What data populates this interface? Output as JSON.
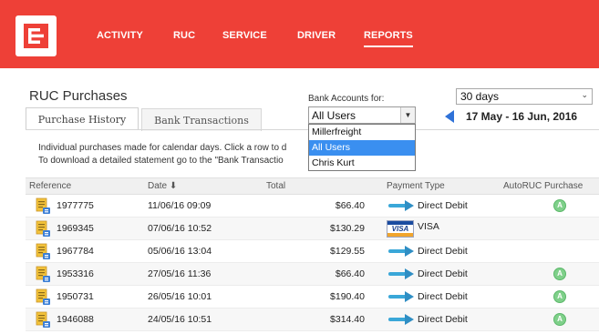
{
  "colors": {
    "brand": "#ee4037",
    "accent": "#2f72d8",
    "selection": "#3a8ff0",
    "autoruc": "#7fd08a"
  },
  "nav": {
    "items": [
      {
        "label": "ACTIVITY",
        "active": false
      },
      {
        "label": "RUC",
        "active": false
      },
      {
        "label": "SERVICE",
        "active": false
      },
      {
        "label": "DRIVER",
        "active": false
      },
      {
        "label": "REPORTS",
        "active": true
      }
    ]
  },
  "page": {
    "title": "RUC Purchases",
    "tabs": [
      {
        "label": "Purchase History",
        "active": true
      },
      {
        "label": "Bank Transactions",
        "active": false
      }
    ]
  },
  "bank_accounts": {
    "label": "Bank Accounts for:",
    "selected": "All Users",
    "options": [
      "Millerfreight",
      "All Users",
      "Chris Kurt"
    ],
    "highlighted": "All Users"
  },
  "period": {
    "selected": "30 days",
    "range": "17 May - 16 Jun, 2016"
  },
  "info": {
    "line1": "Individual purchases made for calendar days. Click a row to d",
    "line2": "To download a detailed statement go to the \"Bank Transactio"
  },
  "table": {
    "columns": [
      "Reference",
      "Date ⬇",
      "Total",
      "Payment Type",
      "AutoRUC Purchase"
    ],
    "rows": [
      {
        "reference": "1977775",
        "date": "11/06/16 09:09",
        "total": "$66.40",
        "payment": "Direct Debit",
        "payment_icon": "arrow-right-icon",
        "autoruc": "A"
      },
      {
        "reference": "1969345",
        "date": "07/06/16 10:52",
        "total": "$130.29",
        "payment": "VISA",
        "payment_icon": "visa-card-icon",
        "autoruc": ""
      },
      {
        "reference": "1967784",
        "date": "05/06/16 13:04",
        "total": "$129.55",
        "payment": "Direct Debit",
        "payment_icon": "arrow-right-icon",
        "autoruc": ""
      },
      {
        "reference": "1953316",
        "date": "27/05/16 11:36",
        "total": "$66.40",
        "payment": "Direct Debit",
        "payment_icon": "arrow-right-icon",
        "autoruc": "A"
      },
      {
        "reference": "1950731",
        "date": "26/05/16 10:01",
        "total": "$190.40",
        "payment": "Direct Debit",
        "payment_icon": "arrow-right-icon",
        "autoruc": "A"
      },
      {
        "reference": "1946088",
        "date": "24/05/16 10:51",
        "total": "$314.40",
        "payment": "Direct Debit",
        "payment_icon": "arrow-right-icon",
        "autoruc": "A"
      }
    ]
  }
}
